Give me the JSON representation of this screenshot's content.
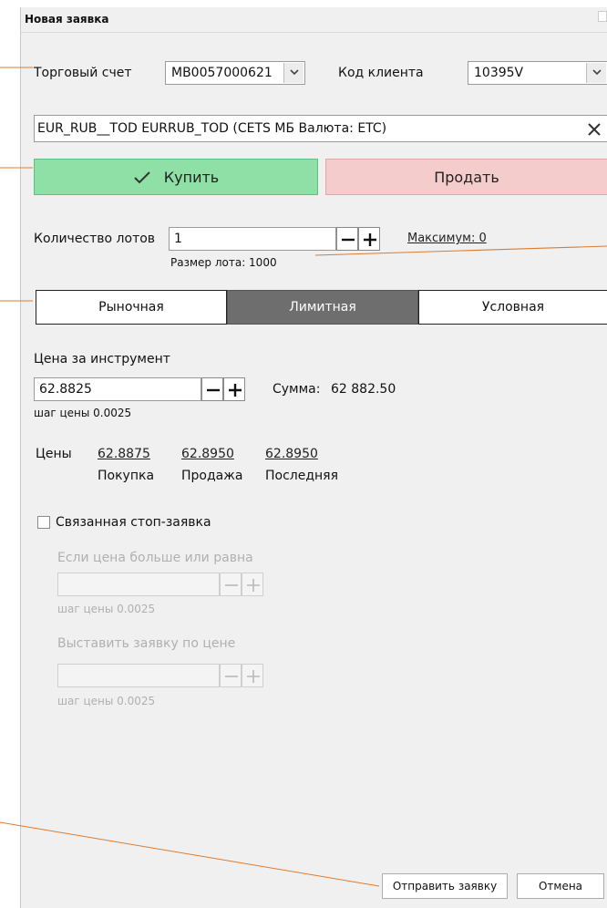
{
  "window": {
    "title": "Новая заявка"
  },
  "account": {
    "label": "Торговый счет",
    "value": "MB0057000621"
  },
  "client": {
    "label": "Код клиента",
    "value": "10395V"
  },
  "instrument": {
    "value": "EUR_RUB__TOD  EURRUB_TOD  (CETS  МБ Валюта: ETC)"
  },
  "side": {
    "buy_label": "Купить",
    "sell_label": "Продать",
    "selected": "buy"
  },
  "lots": {
    "label": "Количество лотов",
    "value": "1",
    "max_label": "Максимум: 0",
    "lot_size": "Размер лота: 1000"
  },
  "order_types": {
    "tabs": [
      "Рыночная",
      "Лимитная",
      "Условная"
    ],
    "active": "Лимитная"
  },
  "price": {
    "label": "Цена за инструмент",
    "value": "62.8825",
    "step": "шаг цены 0.0025",
    "sum_label": "Сумма:",
    "sum_value": "62 882.50"
  },
  "quotes": {
    "label": "Цены",
    "items": [
      {
        "value": "62.8875",
        "caption": "Покупка"
      },
      {
        "value": "62.8950",
        "caption": "Продажа"
      },
      {
        "value": "62.8950",
        "caption": "Последняя"
      }
    ]
  },
  "stop_order": {
    "label": "Связанная стоп-заявка",
    "checked": false,
    "trigger_label": "Если цена больше или равна",
    "trigger_step": "шаг цены 0.0025",
    "place_label": "Выставить заявку по цене",
    "place_step": "шаг цены 0.0025"
  },
  "footer": {
    "submit_label": "Отправить заявку",
    "cancel_label": "Отмена"
  },
  "colors": {
    "buy_bg": "#8fe0a6",
    "sell_bg": "#f5cccc",
    "active_tab": "#6e6e6e",
    "annotation": "#e07a2a"
  }
}
